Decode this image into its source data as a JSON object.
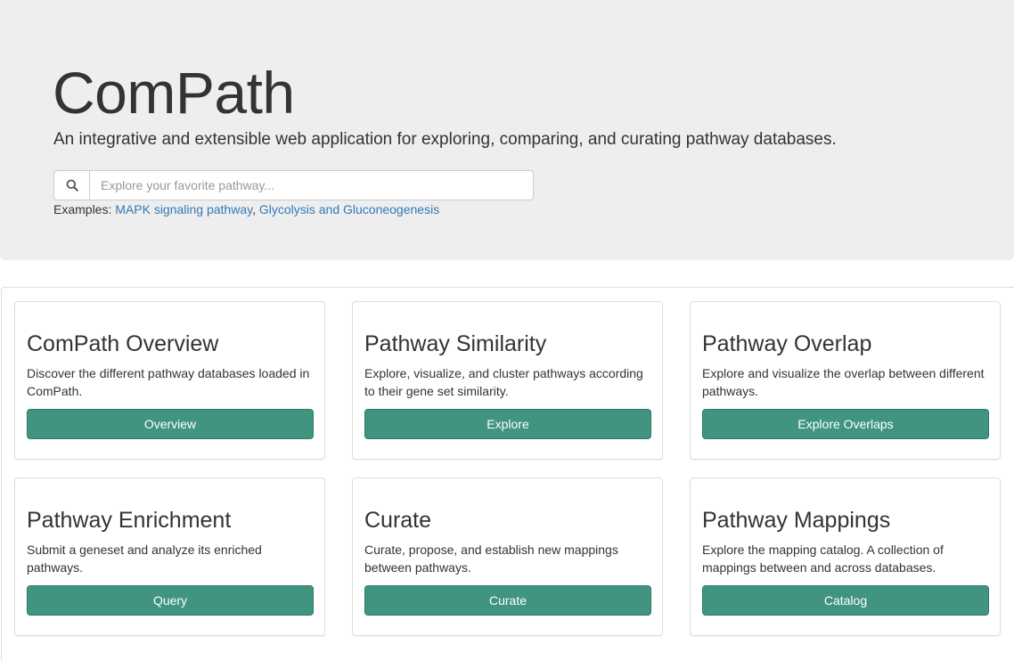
{
  "header": {
    "title": "ComPath",
    "tagline": "An integrative and extensible web application for exploring, comparing, and curating pathway databases."
  },
  "search": {
    "placeholder": "Explore your favorite pathway...",
    "icon": "search-icon",
    "examples_label": "Examples:",
    "example_links": [
      "MAPK signaling pathway",
      "Glycolysis and Gluconeogenesis"
    ],
    "separator": ","
  },
  "cards": [
    {
      "title": "ComPath Overview",
      "description": "Discover the different pathway databases loaded in ComPath.",
      "button": "Overview"
    },
    {
      "title": "Pathway Similarity",
      "description": "Explore, visualize, and cluster pathways according to their gene set similarity.",
      "button": "Explore"
    },
    {
      "title": "Pathway Overlap",
      "description": "Explore and visualize the overlap between different pathways.",
      "button": "Explore Overlaps"
    },
    {
      "title": "Pathway Enrichment",
      "description": "Submit a geneset and analyze its enriched pathways.",
      "button": "Query"
    },
    {
      "title": "Curate",
      "description": "Curate, propose, and establish new mappings between pathways.",
      "button": "Curate"
    },
    {
      "title": "Pathway Mappings",
      "description": "Explore the mapping catalog. A collection of mappings between and across databases.",
      "button": "Catalog"
    }
  ],
  "colors": {
    "jumbotron_bg": "#eeeeee",
    "button_bg": "#409480",
    "link": "#337ab7",
    "text": "#333333"
  }
}
